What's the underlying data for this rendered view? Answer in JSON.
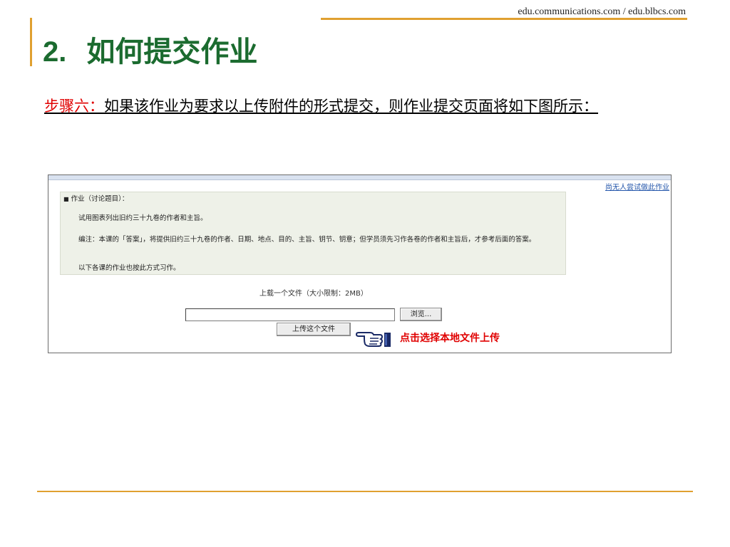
{
  "header": {
    "site_url": "edu.communications.com / edu.blbcs.com",
    "number": "2.",
    "title": "如何提交作业"
  },
  "step": {
    "label": "步骤六：",
    "text": "如果该作业为要求以上传附件的形式提交，则作业提交页面将如下图所示："
  },
  "screenshot": {
    "top_link": "尚无人尝试做此作业",
    "assignment": {
      "heading": "作业（讨论题目）：",
      "bullet": "■",
      "p1": "试用图表列出旧约三十九卷的作者和主旨。",
      "p2": "编注：本课的「答案」，将提供旧约三十九卷的作者、日期、地点、目的、主旨、钥节、钥意；但学员须先习作各卷的作者和主旨后，才参考后面的答案。",
      "p3": "以下各课的作业也按此方式习作。"
    },
    "upload_caption": "上载一个文件（大小限制：2MB）",
    "file_input_value": "",
    "browse_label": "浏览...",
    "upload_button_label": "上传这个文件",
    "hint_icon": "pointing-hand-icon",
    "hint_text": "点击选择本地文件上传",
    "hint_color": "#e00000"
  },
  "colors": {
    "title": "#1b6b2f",
    "accent_rule": "#e0a030",
    "step_label": "#e00000",
    "link": "#2255aa"
  }
}
